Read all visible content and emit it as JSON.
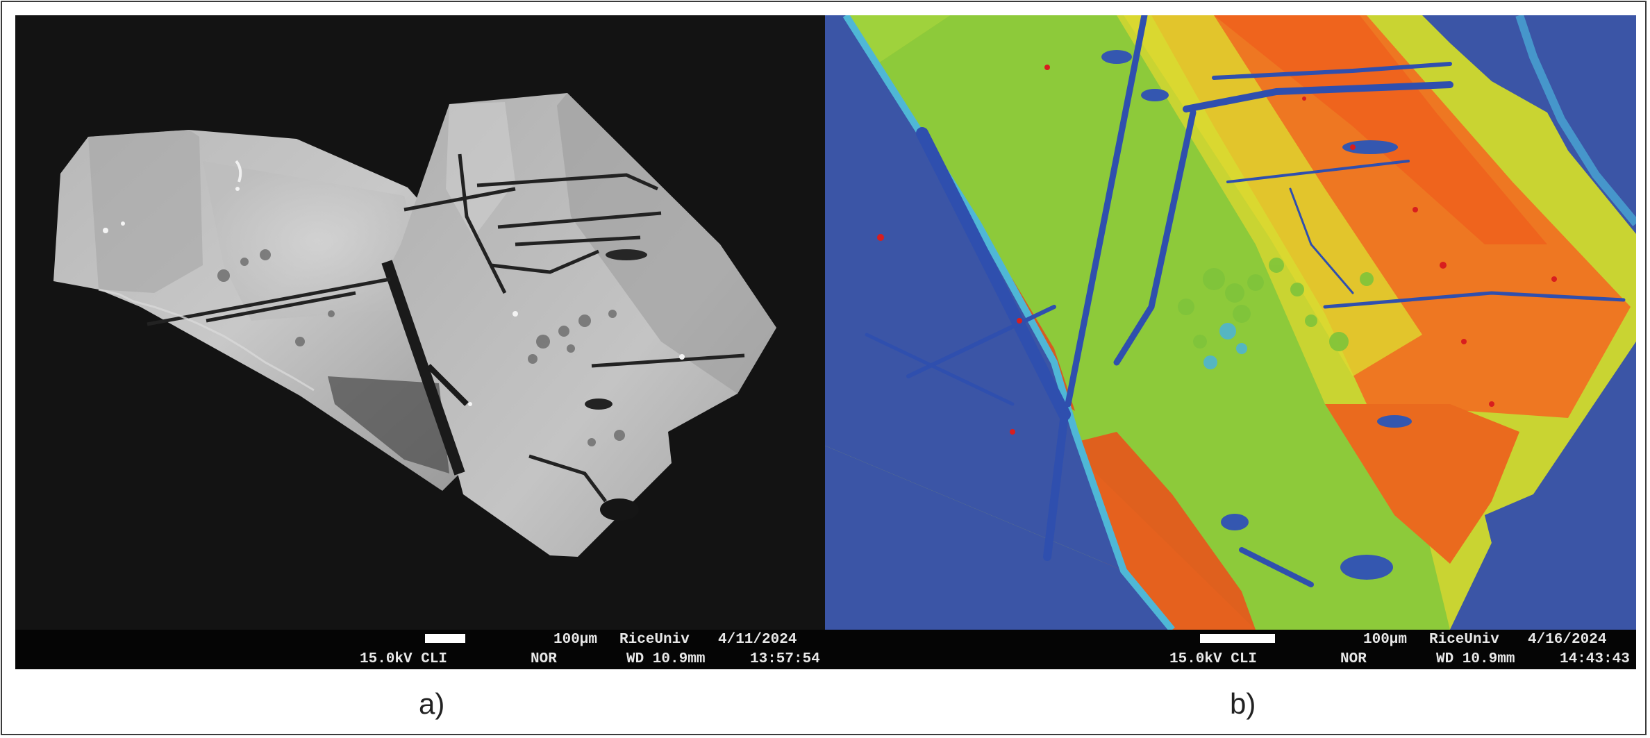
{
  "panels": [
    {
      "caption": "a)",
      "image": "SEM cathodoluminescence image, grayscale",
      "scale_label": "100µm",
      "operator": "RiceUniv",
      "date": "4/11/2024",
      "voltage_mode": "15.0kV CLI",
      "mode": "NOR",
      "working_distance": "WD 10.9mm",
      "time": "13:57:54"
    },
    {
      "caption": "b)",
      "image": "SEM cathodoluminescence image, false color",
      "scale_label": "100µm",
      "operator": "RiceUniv",
      "date": "4/16/2024",
      "voltage_mode": "15.0kV CLI",
      "mode": "NOR",
      "working_distance": "WD 10.9mm",
      "time": "14:43:43"
    }
  ],
  "colors": {
    "background_a": "#131313",
    "background_b": "#3b55a6",
    "green": "#7fc63a",
    "yellow": "#d9d62c",
    "orange": "#ee6a1c",
    "red": "#e02a1c",
    "crack_blue": "#2a4fb0"
  }
}
